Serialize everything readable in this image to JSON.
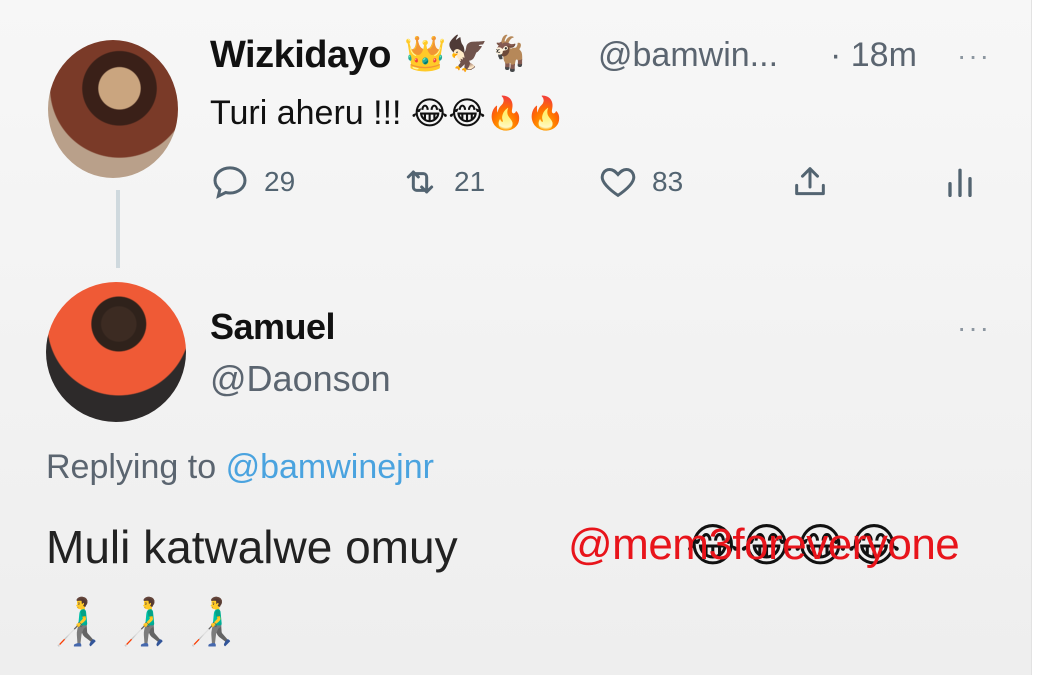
{
  "tweet1": {
    "name": "Wizkidayo",
    "badges": "👑🦅🐐",
    "handle": "@bamwin...",
    "time": "· 18m",
    "more": "···",
    "text": "Turi aheru !!!",
    "emoji": "😂😂🔥🔥",
    "actions": {
      "reply_count": "29",
      "retweet_count": "21",
      "like_count": "83"
    }
  },
  "tweet2": {
    "name": "Samuel",
    "handle": "@Daonson",
    "more": "···",
    "replying_label": "Replying to",
    "replying_handle": "@bamwinejnr",
    "text": "Muli katwalwe omuy",
    "emoji": "😂😂😂😂",
    "walkers": "👨‍🦯👨‍🦯👨‍🦯"
  },
  "watermark": "@mem3foreveryone"
}
